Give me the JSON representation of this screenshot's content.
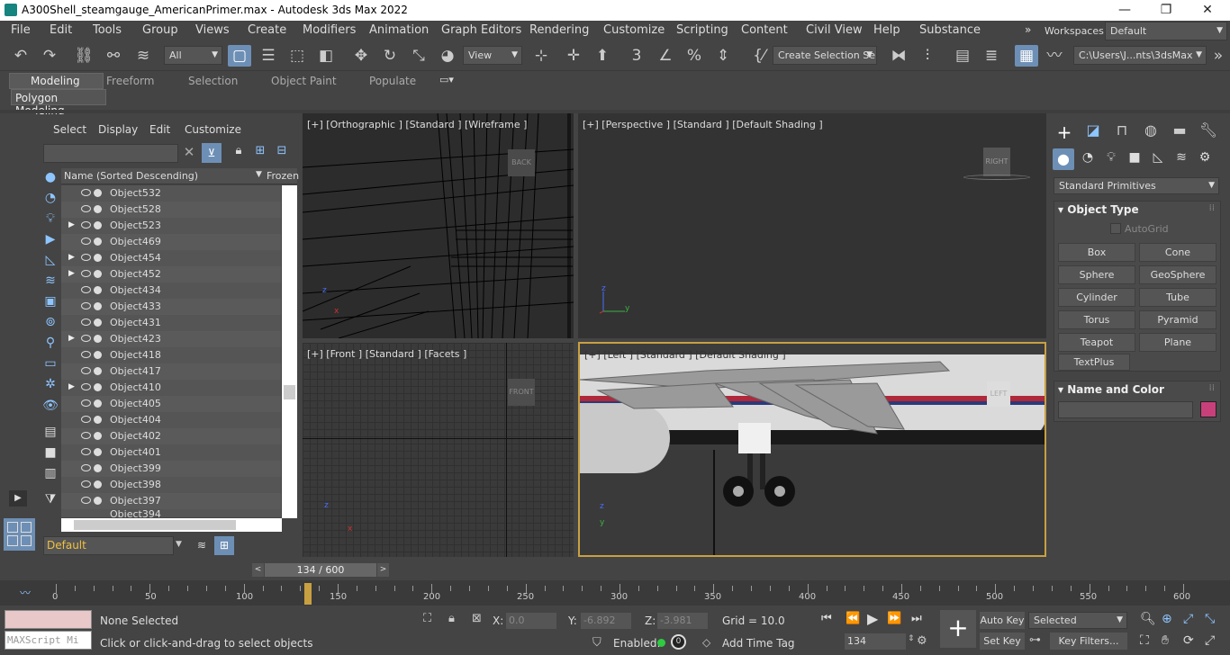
{
  "window": {
    "title": "A300Shell_steamgauge_AmericanPrimer.max - Autodesk 3ds Max 2022",
    "controls": {
      "minimize": "—",
      "maximize": "❐",
      "close": "✕"
    }
  },
  "menu": [
    "File",
    "Edit",
    "Tools",
    "Group",
    "Views",
    "Create",
    "Modifiers",
    "Animation",
    "Graph Editors",
    "Rendering",
    "Customize",
    "Scripting",
    "Content",
    "Civil View",
    "Help",
    "Substance"
  ],
  "workspaces": {
    "label": "Workspaces:",
    "value": "Default"
  },
  "toolbar": {
    "filter": "All",
    "ref_coord": "View",
    "selection_set": "Create Selection Se",
    "project_path": "C:\\Users\\J...nts\\3dsMax"
  },
  "ribbon": {
    "tabs": [
      "Modeling",
      "Freeform",
      "Selection",
      "Object Paint",
      "Populate"
    ],
    "sub_label": "Polygon Modeling"
  },
  "scene_explorer": {
    "menu": [
      "Select",
      "Display",
      "Edit",
      "Customize"
    ],
    "search_placeholder": "",
    "col_name": "Name (Sorted Descending)",
    "col_frozen": "Frozen",
    "rows": [
      {
        "name": "Object532",
        "exp": false
      },
      {
        "name": "Object528",
        "exp": false
      },
      {
        "name": "Object523",
        "exp": true
      },
      {
        "name": "Object469",
        "exp": false
      },
      {
        "name": "Object454",
        "exp": true
      },
      {
        "name": "Object452",
        "exp": true
      },
      {
        "name": "Object434",
        "exp": false
      },
      {
        "name": "Object433",
        "exp": false
      },
      {
        "name": "Object431",
        "exp": false
      },
      {
        "name": "Object423",
        "exp": true
      },
      {
        "name": "Object418",
        "exp": false
      },
      {
        "name": "Object417",
        "exp": false
      },
      {
        "name": "Object410",
        "exp": true
      },
      {
        "name": "Object405",
        "exp": false
      },
      {
        "name": "Object404",
        "exp": false
      },
      {
        "name": "Object402",
        "exp": false
      },
      {
        "name": "Object401",
        "exp": false
      },
      {
        "name": "Object399",
        "exp": false
      },
      {
        "name": "Object398",
        "exp": false
      },
      {
        "name": "Object397",
        "exp": false
      },
      {
        "name": "Object394",
        "exp": false
      }
    ],
    "layer": "Default"
  },
  "viewports": {
    "top_left": "[+] [Orthographic ] [Standard ] [Wireframe ]",
    "top_right": "[+] [Perspective ] [Standard ] [Default Shading ]",
    "bottom_left": "[+] [Front ] [Standard ] [Facets ]",
    "bottom_right": "[+] [Left ] [Standard ] [Default Shading ]",
    "cube_back": "BACK",
    "cube_right": "RIGHT",
    "cube_front": "FRONT",
    "cube_left": "LEFT",
    "axis_z": "z",
    "axis_y": "y",
    "axis_x": "x"
  },
  "command_panel": {
    "dropdown": "Standard Primitives",
    "rollout_object_type": "Object Type",
    "autogrid": "AutoGrid",
    "buttons": [
      "Box",
      "Cone",
      "Sphere",
      "GeoSphere",
      "Cylinder",
      "Tube",
      "Torus",
      "Pyramid",
      "Teapot",
      "Plane",
      "TextPlus"
    ],
    "rollout_name_color": "Name and Color",
    "object_color": "#c8407a"
  },
  "timeline": {
    "slider_label": "134 / 600",
    "ticks": [
      "0",
      "50",
      "100",
      "150",
      "200",
      "250",
      "300",
      "350",
      "400",
      "450",
      "500",
      "550",
      "600"
    ],
    "current_frame": 134,
    "total_frames": 600
  },
  "status": {
    "maxscript": "MAXScript Mi",
    "selection": "None Selected",
    "prompt": "Click or click-and-drag to select objects",
    "x_label": "X:",
    "x": "0.0",
    "y_label": "Y:",
    "y": "-6.892",
    "z_label": "Z:",
    "z": "-3.981",
    "grid": "Grid = 10.0",
    "enabled": "Enabled:",
    "add_time_tag": "Add Time Tag",
    "frame": "134",
    "auto_key": "Auto Key",
    "selected": "Selected",
    "set_key": "Set Key",
    "key_filters": "Key Filters..."
  }
}
